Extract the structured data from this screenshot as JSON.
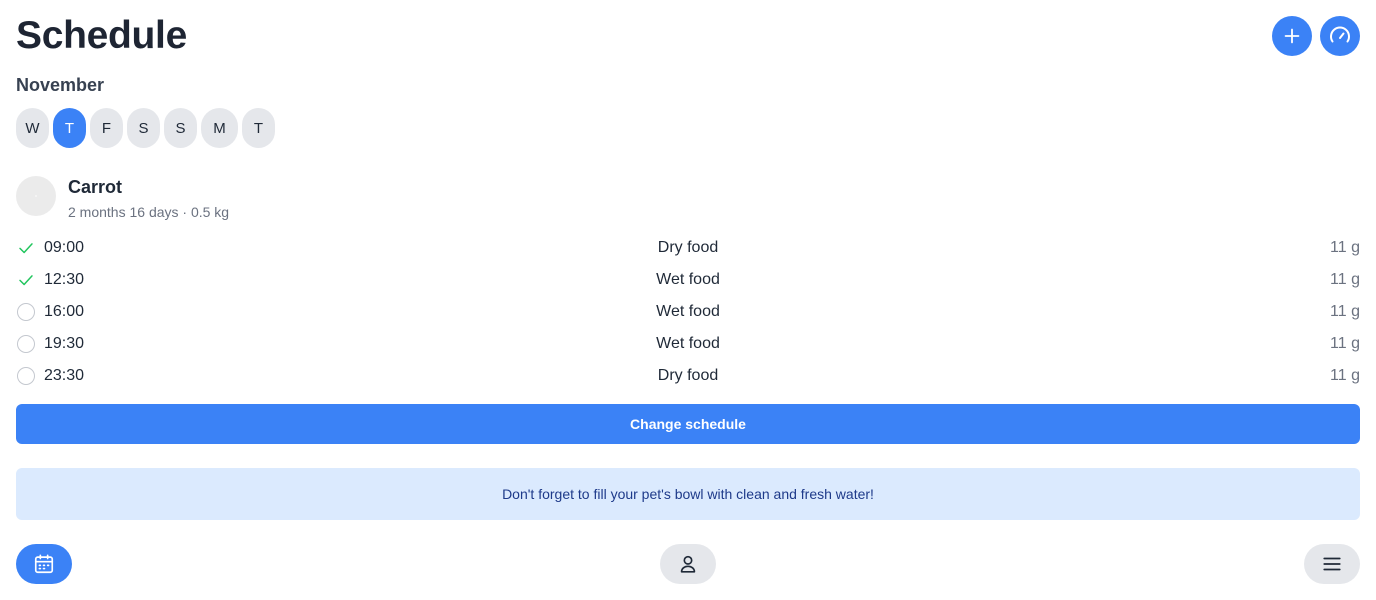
{
  "header": {
    "title": "Schedule",
    "add_icon": "plus-icon",
    "gauge_icon": "speedometer-icon"
  },
  "calendar": {
    "month": "November",
    "days": [
      "W",
      "T",
      "F",
      "S",
      "S",
      "M",
      "T"
    ],
    "selected_index": 1
  },
  "pet": {
    "name": "Carrot",
    "meta": "2 months 16 days · 0.5 kg"
  },
  "feedings": [
    {
      "time": "09:00",
      "food": "Dry food",
      "amount": "11 g",
      "done": true
    },
    {
      "time": "12:30",
      "food": "Wet food",
      "amount": "11 g",
      "done": true
    },
    {
      "time": "16:00",
      "food": "Wet food",
      "amount": "11 g",
      "done": false
    },
    {
      "time": "19:30",
      "food": "Wet food",
      "amount": "11 g",
      "done": false
    },
    {
      "time": "23:30",
      "food": "Dry food",
      "amount": "11 g",
      "done": false
    }
  ],
  "change_button_label": "Change schedule",
  "notice": "Don't forget to fill your pet's bowl with clean and fresh water!",
  "bottom_nav": {
    "calendar_icon": "calendar-icon",
    "profile_icon": "user-icon",
    "menu_icon": "hamburger-menu-icon",
    "active": "calendar"
  },
  "colors": {
    "accent": "#3b82f6",
    "check": "#22c55e",
    "notice_bg": "#dbeafe",
    "notice_text": "#1e3a8a"
  }
}
